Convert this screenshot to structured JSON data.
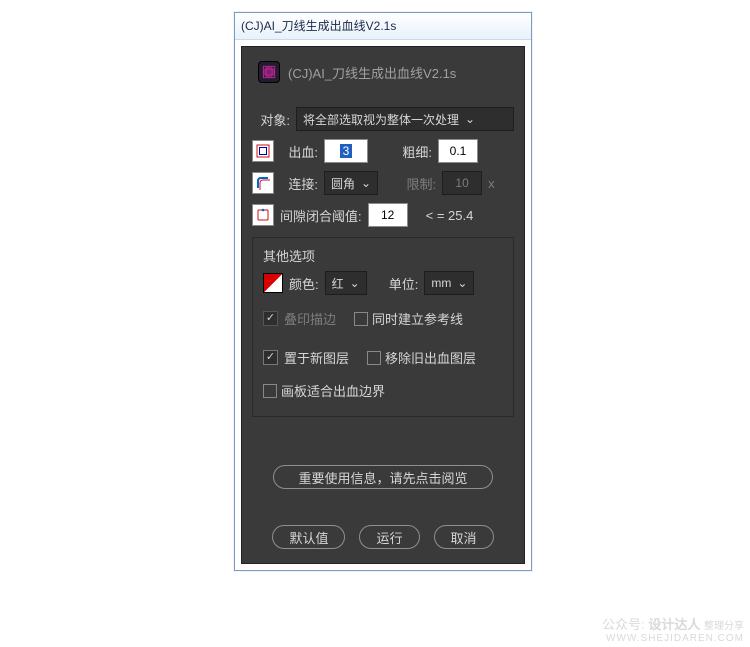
{
  "window": {
    "title": "(CJ)AI_刀线生成出血线V2.1s"
  },
  "header": {
    "title": "(CJ)AI_刀线生成出血线V2.1s"
  },
  "labels": {
    "object": "对象:",
    "bleed": "出血:",
    "thickness": "粗细:",
    "join": "连接:",
    "limit": "限制:",
    "x": "x",
    "gap_threshold": "间隙闭合阈值:",
    "gap_hint": "< = 25.4",
    "other_options": "其他选项",
    "color": "颜色:",
    "unit": "单位:"
  },
  "selects": {
    "object": "将全部选取视为整体一次处理",
    "join": "圆角",
    "color": "红",
    "unit": "mm"
  },
  "values": {
    "bleed": "3",
    "thickness": "0.1",
    "limit": "10",
    "gap_threshold": "12"
  },
  "checkboxes": {
    "overprint_stroke": {
      "label": "叠印描边",
      "checked": true,
      "disabled": true
    },
    "create_guides": {
      "label": "同时建立参考线"
    },
    "new_layer": {
      "label": "置于新图层",
      "checked": true
    },
    "remove_old": {
      "label": "移除旧出血图层"
    },
    "artboard_fit": {
      "label": "画板适合出血边界"
    }
  },
  "buttons": {
    "info": "重要使用信息，请先点击阅览",
    "default": "默认值",
    "run": "运行",
    "cancel": "取消"
  },
  "watermark": {
    "label": "公众号:",
    "name": "设计达人",
    "sub": "整理分享",
    "url": "WWW.SHEJIDAREN.COM"
  }
}
